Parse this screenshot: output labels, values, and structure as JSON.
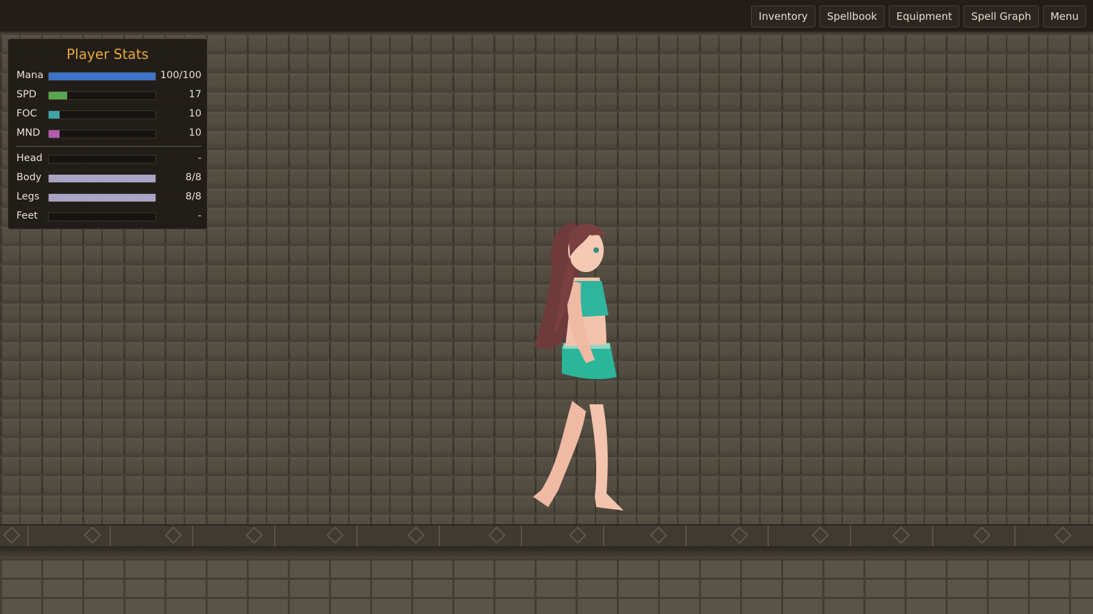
{
  "topbar": {
    "buttons": [
      "Inventory",
      "Spellbook",
      "Equipment",
      "Spell Graph",
      "Menu"
    ]
  },
  "stats_panel": {
    "title": "Player Stats",
    "stats": [
      {
        "label": "Mana",
        "value": "100/100",
        "fill": 1.0,
        "color": "#3d73c8"
      },
      {
        "label": "SPD",
        "value": "17",
        "fill": 0.17,
        "color": "#5aa64f"
      },
      {
        "label": "FOC",
        "value": "10",
        "fill": 0.1,
        "color": "#3fa3a8"
      },
      {
        "label": "MND",
        "value": "10",
        "fill": 0.1,
        "color": "#b25bb0"
      }
    ],
    "equipment": [
      {
        "label": "Head",
        "value": "-",
        "fill": 0,
        "color": "#a9a4c3"
      },
      {
        "label": "Body",
        "value": "8/8",
        "fill": 1.0,
        "color": "#a9a4c3"
      },
      {
        "label": "Legs",
        "value": "8/8",
        "fill": 1.0,
        "color": "#a9a4c3"
      },
      {
        "label": "Feet",
        "value": "-",
        "fill": 0,
        "color": "#a9a4c3"
      }
    ]
  }
}
